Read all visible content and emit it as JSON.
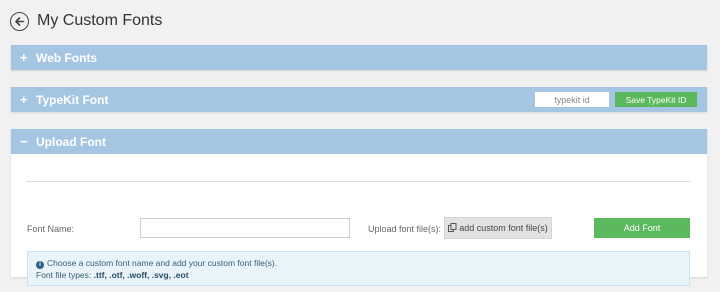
{
  "page": {
    "title": "My Custom Fonts"
  },
  "panels": {
    "web_fonts": {
      "toggle": "+",
      "title": "Web Fonts"
    },
    "typekit": {
      "toggle": "+",
      "title": "TypeKit Font",
      "input_placeholder": "typekit id",
      "save_label": "Save TypeKit ID"
    },
    "upload": {
      "toggle": "−",
      "title": "Upload Font",
      "font_name_label": "Font Name:",
      "font_name_value": "",
      "upload_label": "Upload font file(s):",
      "upload_button_label": "add custom font file(s)",
      "add_button_label": "Add Font",
      "info_text": "Choose a custom font name and add your custom font file(s).",
      "file_types_prefix": "Font file types: ",
      "file_types": ".ttf, .otf, .woff, .svg, .eot"
    }
  },
  "colors": {
    "panel_header": "#a5c6e3",
    "success": "#5cb85c",
    "info_background": "#e8f4f9"
  }
}
